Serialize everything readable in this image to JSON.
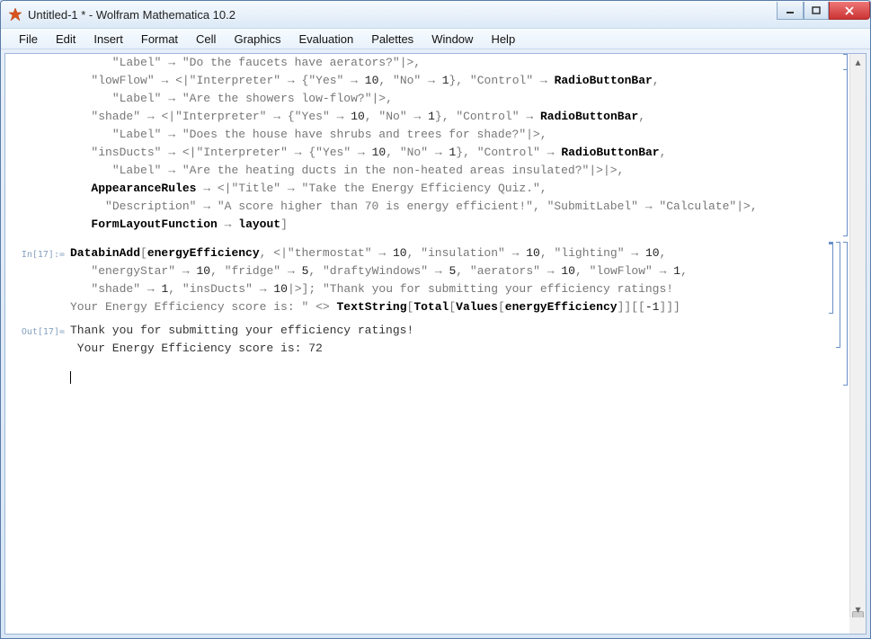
{
  "window": {
    "title": "Untitled-1 * - Wolfram Mathematica 10.2"
  },
  "menu": {
    "file": "File",
    "edit": "Edit",
    "insert": "Insert",
    "format": "Format",
    "cell": "Cell",
    "graphics": "Graphics",
    "evaluation": "Evaluation",
    "palettes": "Palettes",
    "window": "Window",
    "help": "Help"
  },
  "labels": {
    "in17": "In[17]:=",
    "out17": "Out[17]="
  },
  "code_block1": {
    "l1": "      \"Label\" → \"Do the faucets have aerators?\"|>,",
    "l2": "   \"lowFlow\" → <|\"Interpreter\" → {\"Yes\" → 10, \"No\" → 1}, \"Control\" → RadioButtonBar,",
    "l3": "      \"Label\" → \"Are the showers low-flow?\"|>,",
    "l4": "   \"shade\" → <|\"Interpreter\" → {\"Yes\" → 10, \"No\" → 1}, \"Control\" → RadioButtonBar,",
    "l5": "      \"Label\" → \"Does the house have shrubs and trees for shade?\"|>,",
    "l6": "   \"insDucts\" → <|\"Interpreter\" → {\"Yes\" → 10, \"No\" → 1}, \"Control\" → RadioButtonBar,",
    "l7": "      \"Label\" → \"Are the heating ducts in the non-heated areas insulated?\"|>|>,",
    "l8": "   AppearanceRules → <|\"Title\" → \"Take the Energy Efficiency Quiz.\",",
    "l9": "     \"Description\" → \"A score higher than 70 is energy efficient!\", \"SubmitLabel\" → \"Calculate\"|>,",
    "l10": "   FormLayoutFunction → layout]"
  },
  "code_block2": {
    "l1": "DatabinAdd[energyEfficiency, <|\"thermostat\" → 10, \"insulation\" → 10, \"lighting\" → 10,",
    "l2": "   \"energyStar\" → 10, \"fridge\" → 5, \"draftyWindows\" → 5, \"aerators\" → 10, \"lowFlow\" → 1,",
    "l3": "   \"shade\" → 1, \"insDucts\" → 10|>]; \"Thank you for submitting your efficiency ratings!",
    "l4": "Your Energy Efficiency score is: \" <> TextString[Total[Values[energyEfficiency]][[-1]]]"
  },
  "output": {
    "l1": "Thank you for submitting your efficiency ratings!",
    "l2": " Your Energy Efficiency score is: 72"
  }
}
